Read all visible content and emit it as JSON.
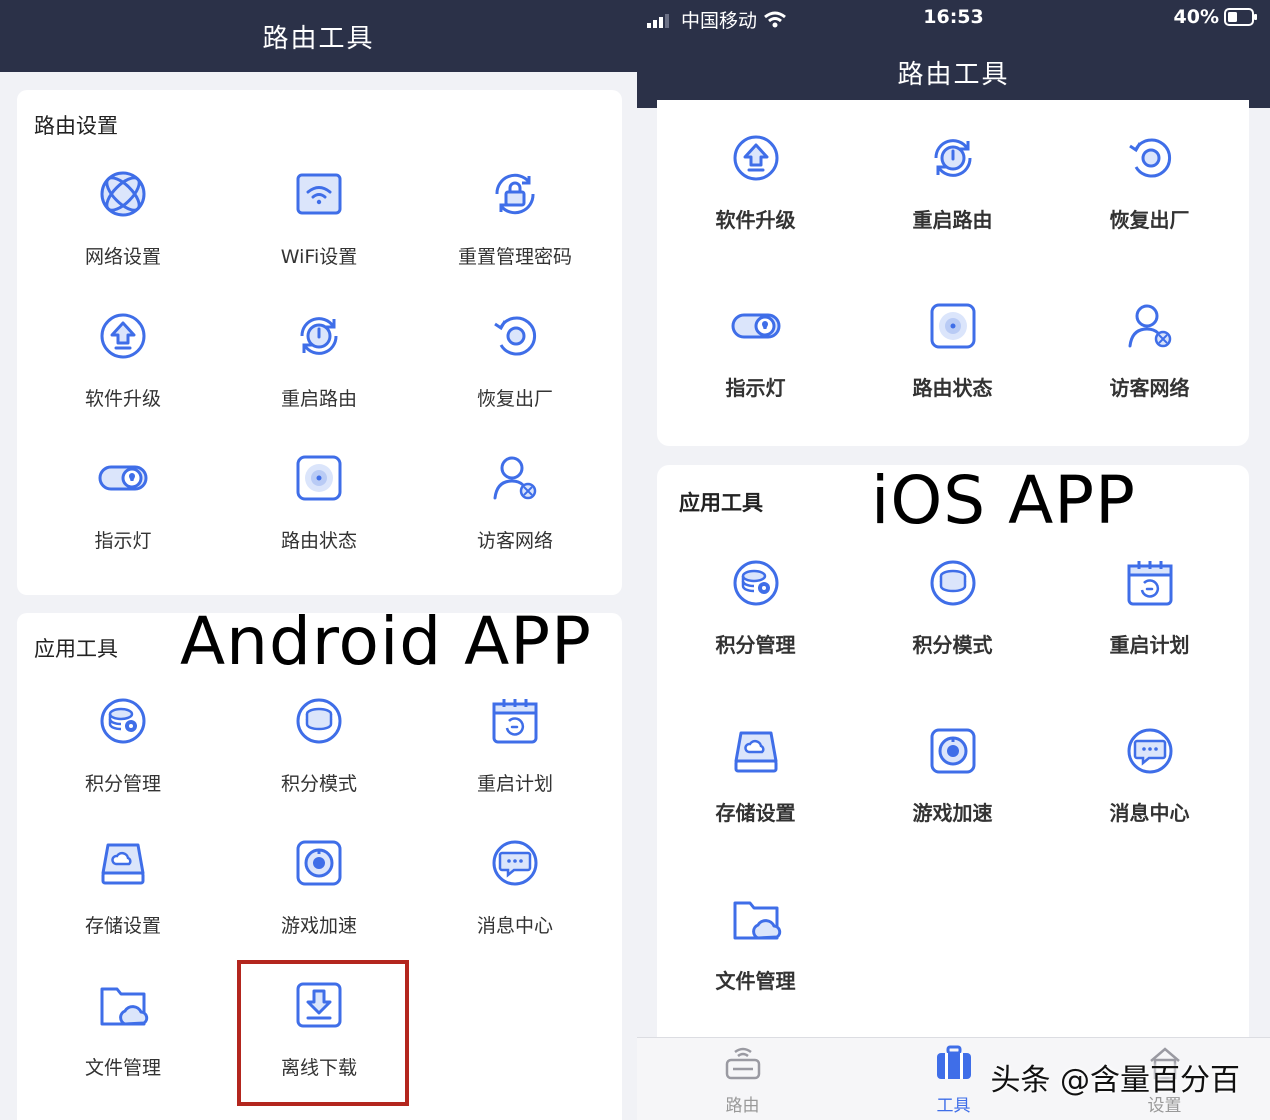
{
  "colors": {
    "header_bg": "#2b3148",
    "icon_blue": "#3f6ee8",
    "highlight_red": "#b3261e",
    "page_bg": "#f1f2f6"
  },
  "android": {
    "title": "路由工具",
    "router_section": {
      "title": "路由设置",
      "items": [
        {
          "label": "网络设置",
          "icon": "globe-icon"
        },
        {
          "label": "WiFi设置",
          "icon": "wifi-icon"
        },
        {
          "label": "重置管理密码",
          "icon": "lock-icon"
        },
        {
          "label": "软件升级",
          "icon": "upgrade-icon"
        },
        {
          "label": "重启路由",
          "icon": "restart-icon"
        },
        {
          "label": "恢复出厂",
          "icon": "factory-reset-icon"
        },
        {
          "label": "指示灯",
          "icon": "indicator-light-icon"
        },
        {
          "label": "路由状态",
          "icon": "router-status-icon"
        },
        {
          "label": "访客网络",
          "icon": "guest-network-icon"
        }
      ]
    },
    "app_section": {
      "title": "应用工具",
      "items": [
        {
          "label": "积分管理",
          "icon": "points-manage-icon"
        },
        {
          "label": "积分模式",
          "icon": "points-mode-icon"
        },
        {
          "label": "重启计划",
          "icon": "calendar-icon"
        },
        {
          "label": "存储设置",
          "icon": "storage-icon"
        },
        {
          "label": "游戏加速",
          "icon": "game-boost-icon"
        },
        {
          "label": "消息中心",
          "icon": "message-icon"
        },
        {
          "label": "文件管理",
          "icon": "folder-icon"
        },
        {
          "label": "离线下载",
          "icon": "download-icon"
        }
      ]
    },
    "overlay_label": "Android APP"
  },
  "ios": {
    "status": {
      "carrier": "中国移动",
      "time": "16:53",
      "battery": "40%"
    },
    "title": "路由工具",
    "router_items": [
      {
        "label": "软件升级",
        "icon": "upgrade-icon"
      },
      {
        "label": "重启路由",
        "icon": "restart-icon"
      },
      {
        "label": "恢复出厂",
        "icon": "factory-reset-icon"
      },
      {
        "label": "指示灯",
        "icon": "indicator-light-icon"
      },
      {
        "label": "路由状态",
        "icon": "router-status-icon"
      },
      {
        "label": "访客网络",
        "icon": "guest-network-icon"
      }
    ],
    "app_section": {
      "title": "应用工具",
      "items": [
        {
          "label": "积分管理",
          "icon": "points-manage-icon"
        },
        {
          "label": "积分模式",
          "icon": "points-mode-icon"
        },
        {
          "label": "重启计划",
          "icon": "calendar-icon"
        },
        {
          "label": "存储设置",
          "icon": "storage-icon"
        },
        {
          "label": "游戏加速",
          "icon": "game-boost-icon"
        },
        {
          "label": "消息中心",
          "icon": "message-icon"
        },
        {
          "label": "文件管理",
          "icon": "folder-icon"
        }
      ]
    },
    "overlay_label": "iOS APP",
    "tabbar": [
      {
        "label": "路由",
        "icon": "router-tab-icon"
      },
      {
        "label": "工具",
        "icon": "toolbox-tab-icon",
        "active": true
      },
      {
        "label": "设置",
        "icon": "settings-tab-icon"
      }
    ],
    "watermark": "头条 @含量百分百"
  }
}
